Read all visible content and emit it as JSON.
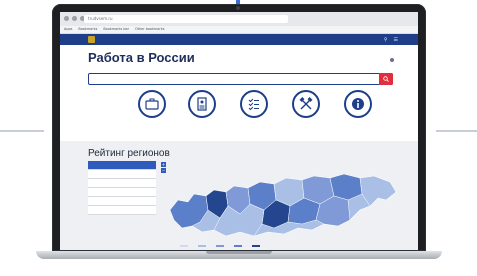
{
  "browser": {
    "address": "trudvsem.ru",
    "bookmarks": [
      "Apps",
      "Bookmarks",
      "Bookmarks bar",
      "Other bookmarks"
    ]
  },
  "site_nav": {
    "links": [
      "",
      ""
    ],
    "right_icons": [
      "search-icon",
      "menu-icon"
    ]
  },
  "header": {
    "title": "Работа в России",
    "subtitle": "",
    "link_blind": "",
    "link_login": ""
  },
  "search": {
    "placeholder_prefix": "",
    "placeholder_link": ""
  },
  "features": [
    {
      "label": "",
      "icon": "briefcase-icon"
    },
    {
      "label": "",
      "icon": "resume-icon"
    },
    {
      "label": "",
      "icon": "checklist-icon"
    },
    {
      "label": "",
      "icon": "hammers-icon"
    },
    {
      "label": "",
      "icon": "info-icon"
    }
  ],
  "ratings": {
    "title": "Рейтинг регионов",
    "menu": [
      "",
      "",
      "",
      "",
      "",
      ""
    ],
    "zoom_in": "+",
    "zoom_out": "−",
    "legend": [
      "",
      "",
      "",
      "",
      ""
    ]
  },
  "colors": {
    "brand_blue": "#1e3e8a",
    "accent_red": "#e02e3d",
    "map_light": "#a9bfe6",
    "map_mid": "#5b7fc9",
    "map_dark": "#24468f"
  }
}
